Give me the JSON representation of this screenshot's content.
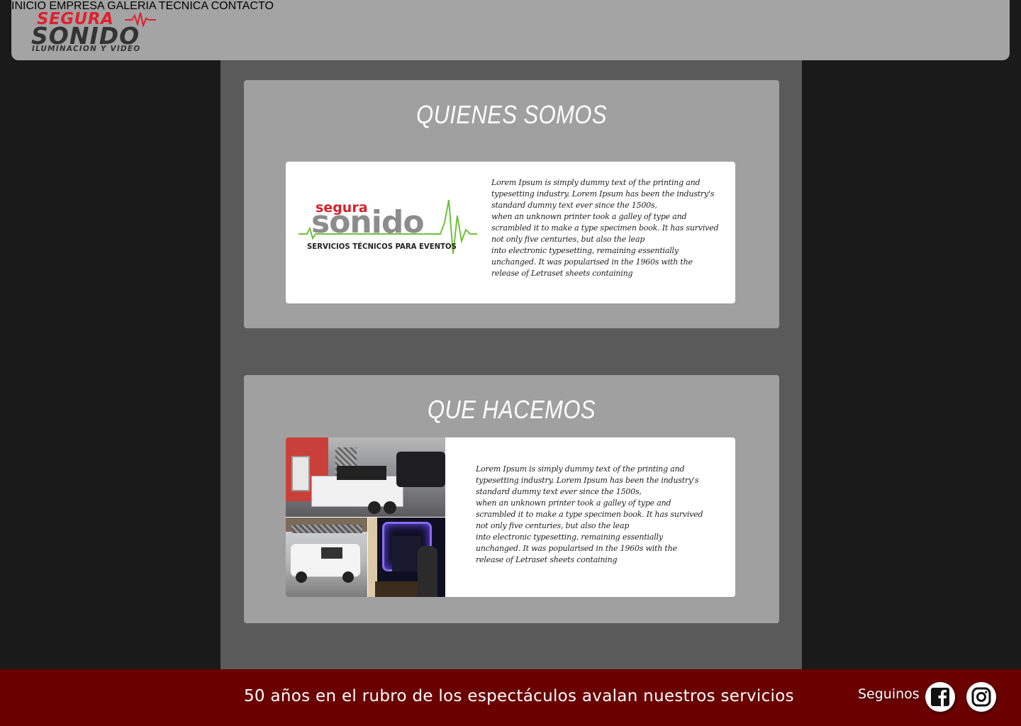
{
  "brand": {
    "logo_line1": "SEGURA",
    "logo_line2": "SONIDO",
    "logo_line3": "ILUMINACION Y VIDEO"
  },
  "nav": [
    "INICIO",
    "EMPRESA",
    "GALERIA",
    "TECNICA",
    "CONTACTO"
  ],
  "sections": [
    {
      "title": "QUIENES SOMOS",
      "card_logo": {
        "line1": "segura",
        "line2": "sonido",
        "line3": "SERVICIOS TÉCNICOS PARA EVENTOS"
      },
      "body": "Lorem Ipsum is simply dummy text of the printing and typesetting industry. Lorem Ipsum has been the industry's standard dummy text ever since the 1500s,\n when an unknown printer took a galley of type and scrambled it to make a type specimen book. It has survived not only five centuries, but also the leap\ninto electronic typesetting, remaining essentially unchanged. It was popularised in the 1960s with the release of Letraset sheets containing"
    },
    {
      "title": "QUE HACEMOS",
      "body": "Lorem Ipsum is simply dummy text of the printing and typesetting industry. Lorem Ipsum has been the industry's standard dummy text ever since the 1500s,\n when an unknown printer took a galley of type and scrambled it to make a type specimen book. It has survived not only five centuries, but also the leap\ninto electronic typesetting, remaining essentially unchanged. It was popularised in the 1960s with the release of Letraset sheets containing"
    }
  ],
  "footer": {
    "tagline": "50 años en el rubro de los espectáculos avalan nuestros servicios",
    "follow_label": "Seguinos",
    "social": [
      "facebook-icon",
      "instagram-icon"
    ]
  },
  "colors": {
    "accent_red": "#e0202e",
    "footer_bg": "#6b0001",
    "navbar_bg": "#a4a4a4",
    "panel_bg": "#a0a0a0",
    "page_bg": "#1b1a1b",
    "column_bg": "#5a5a5a"
  }
}
